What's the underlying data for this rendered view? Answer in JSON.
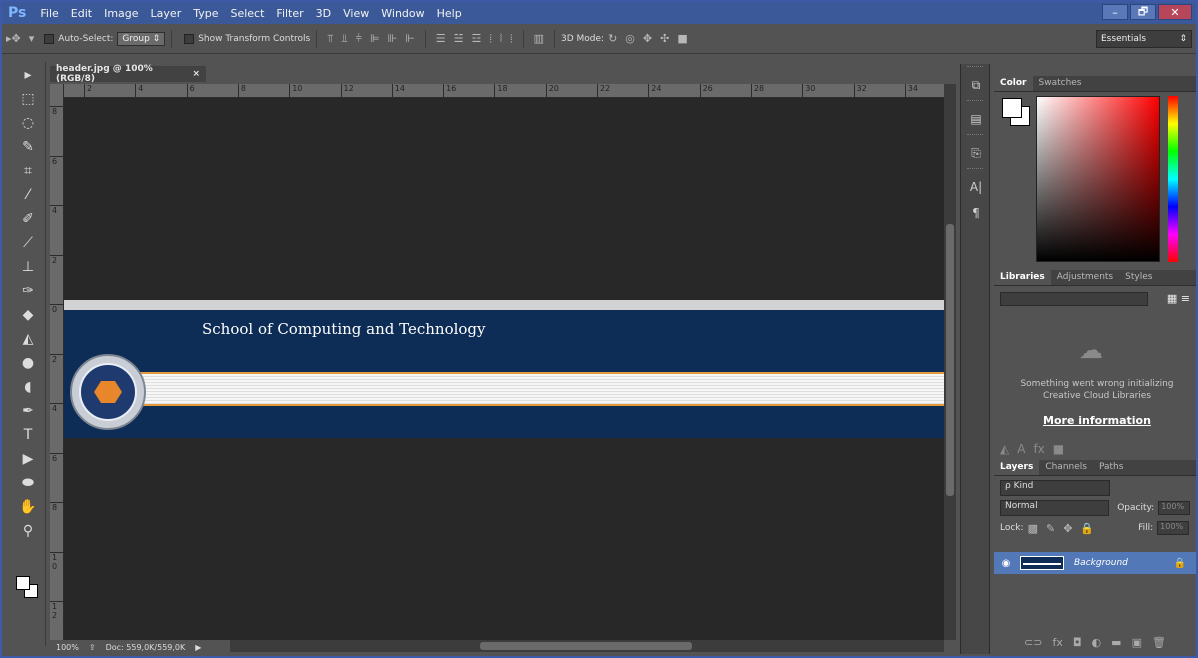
{
  "app": {
    "logo": "Ps",
    "menu": [
      "File",
      "Edit",
      "Image",
      "Layer",
      "Type",
      "Select",
      "Filter",
      "3D",
      "View",
      "Window",
      "Help"
    ],
    "window_controls": [
      "–",
      "🗗",
      "✕"
    ]
  },
  "options": {
    "auto_select_label": "Auto-Select:",
    "auto_select_value": "Group",
    "show_transform_label": "Show Transform Controls",
    "mode_3d_label": "3D Mode:",
    "workspace": "Essentials"
  },
  "document": {
    "tab_title": "header.jpg @ 100% (RGB/8)",
    "tab_close": "×",
    "ruler_h": [
      "2",
      "4",
      "6",
      "8",
      "10",
      "12",
      "14",
      "16",
      "18",
      "20",
      "22",
      "24",
      "26",
      "28",
      "30",
      "32",
      "34"
    ],
    "ruler_v": [
      "8",
      "6",
      "4",
      "2",
      "0",
      "2",
      "4",
      "6",
      "8",
      "1 0",
      "1 2"
    ],
    "banner_title": "School of Computing and Technology"
  },
  "status": {
    "zoom": "100%",
    "doc_size": "Doc: 559,0K/559,0K"
  },
  "color_panel": {
    "tabs": [
      "Color",
      "Swatches"
    ]
  },
  "libraries_panel": {
    "tabs": [
      "Libraries",
      "Adjustments",
      "Styles"
    ],
    "error_line1": "Something went wrong initializing",
    "error_line2": "Creative Cloud Libraries",
    "more_info": "More information"
  },
  "layers_panel": {
    "tabs": [
      "Layers",
      "Channels",
      "Paths"
    ],
    "kind": "ρ Kind",
    "blend_mode": "Normal",
    "opacity_label": "Opacity:",
    "opacity_value": "100%",
    "lock_label": "Lock:",
    "fill_label": "Fill:",
    "fill_value": "100%",
    "layer_name": "Background"
  },
  "colors": {
    "menubar": "#3b5998",
    "banner_navy": "#0d2d57",
    "banner_orange": "#e39a3a",
    "selected_layer": "#5278b8"
  }
}
